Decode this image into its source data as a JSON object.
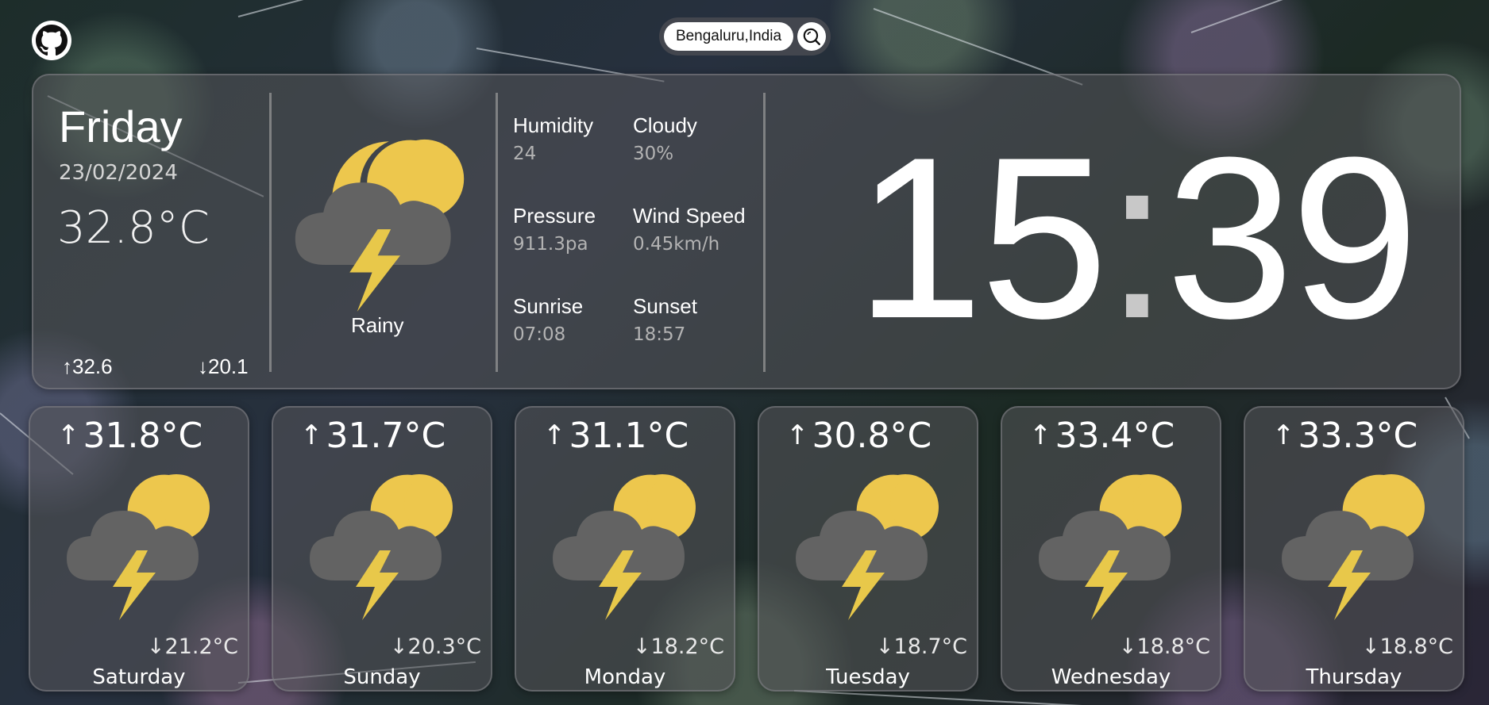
{
  "location": "Bengaluru,India",
  "icons": {
    "github": "github-icon",
    "search": "search-icon",
    "weather": "thunderstorm-night-icon"
  },
  "colors": {
    "moon": "#edc74d",
    "cloud": "#636363",
    "bolt": "#e8c84a"
  },
  "current": {
    "day": "Friday",
    "date": "23/02/2024",
    "temp": "32.8°C",
    "high": "↑32.6",
    "low": "↓20.1",
    "condition": "Rainy",
    "stats": {
      "humidity_label": "Humidity",
      "humidity": "24",
      "cloudy_label": "Cloudy",
      "cloudy": "30%",
      "pressure_label": "Pressure",
      "pressure": "911.3pa",
      "wind_label": "Wind Speed",
      "wind": "0.45km/h",
      "sunrise_label": "Sunrise",
      "sunrise": "07:08",
      "sunset_label": "Sunset",
      "sunset": "18:57"
    },
    "time_hours": "15",
    "time_minutes": "39"
  },
  "forecast": [
    {
      "day": "Saturday",
      "high": "31.8°C",
      "low": "↓21.2°C"
    },
    {
      "day": "Sunday",
      "high": "31.7°C",
      "low": "↓20.3°C"
    },
    {
      "day": "Monday",
      "high": "31.1°C",
      "low": "↓18.2°C"
    },
    {
      "day": "Tuesday",
      "high": "30.8°C",
      "low": "↓18.7°C"
    },
    {
      "day": "Wednesday",
      "high": "33.4°C",
      "low": "↓18.8°C"
    },
    {
      "day": "Thursday",
      "high": "33.3°C",
      "low": "↓18.8°C"
    }
  ]
}
